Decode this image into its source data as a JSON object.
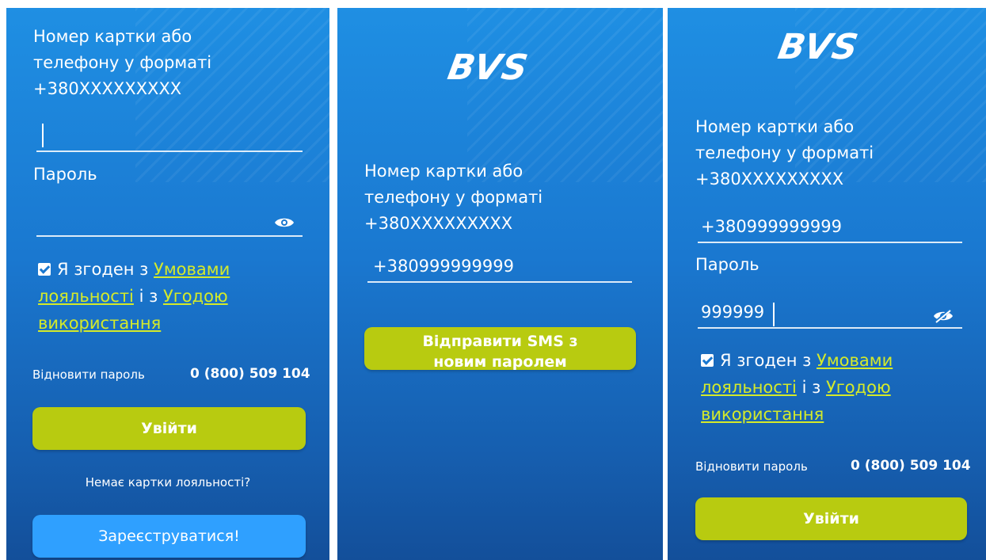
{
  "brand": {
    "logo_text": "BVS"
  },
  "screen1": {
    "card_label": "Номер картки або\nтелефону у форматі\n+380XXXXXXXXX",
    "card_value": "",
    "password_label": "Пароль",
    "password_value": "",
    "agree_prefix": "Я згоден з",
    "terms_link": "Умовами лояльності",
    "agree_middle": "і з",
    "usage_link": "Угодою використання",
    "restore_password": "Відновити пароль",
    "phone": "0 (800) 509 104",
    "login_button": "Увійти",
    "no_card_text": "Немає картки лояльності?",
    "register_button": "Зареєструватися!"
  },
  "screen2": {
    "card_label": "Номер картки або\nтелефону у форматі\n+380XXXXXXXXX",
    "card_value": "+380999999999",
    "send_sms_button": "Відправити SMS з новим паролем"
  },
  "screen3": {
    "card_label": "Номер картки або\nтелефону у форматі\n+380XXXXXXXXX",
    "card_value": "+380999999999",
    "password_label": "Пароль",
    "password_value": "999999",
    "agree_prefix": "Я згоден з",
    "terms_link": "Умовами лояльності",
    "agree_middle": "і з",
    "usage_link": "Угодою використання",
    "restore_password": "Відновити пароль",
    "phone": "0 (800) 509 104",
    "login_button": "Увійти"
  },
  "colors": {
    "accent_green": "#b8cb10",
    "link": "#d4ea2a",
    "register_blue": "#2fa0ff"
  }
}
